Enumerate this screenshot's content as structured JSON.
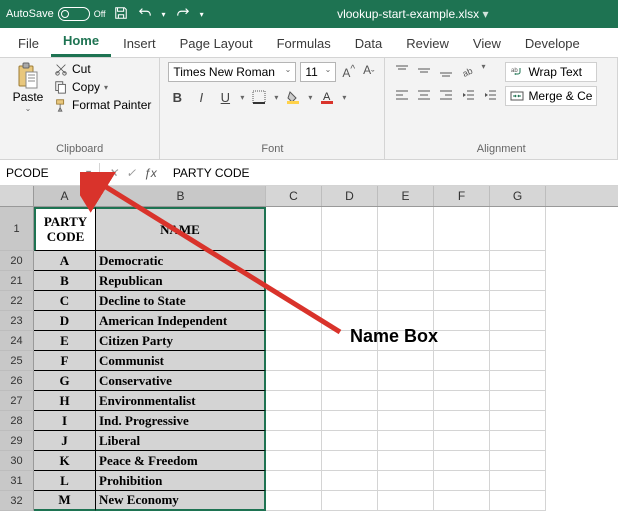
{
  "titlebar": {
    "autosave_label": "AutoSave",
    "autosave_state": "Off",
    "filename": "vlookup-start-example.xlsx"
  },
  "tabs": {
    "items": [
      "File",
      "Home",
      "Insert",
      "Page Layout",
      "Formulas",
      "Data",
      "Review",
      "View",
      "Develope"
    ],
    "active": 1
  },
  "ribbon": {
    "clipboard": {
      "paste": "Paste",
      "cut": "Cut",
      "copy": "Copy",
      "format_painter": "Format Painter",
      "group_label": "Clipboard"
    },
    "font": {
      "name": "Times New Roman",
      "size": "11",
      "group_label": "Font"
    },
    "alignment": {
      "wrap": "Wrap Text",
      "merge": "Merge & Ce",
      "group_label": "Alignment"
    }
  },
  "formula_bar": {
    "name_box": "PCODE",
    "fx_value": "PARTY CODE"
  },
  "columns": [
    "A",
    "B",
    "C",
    "D",
    "E",
    "F",
    "G"
  ],
  "header_row": {
    "num": "1",
    "a": "PARTY CODE",
    "b": "NAME"
  },
  "data_rows": [
    {
      "num": "20",
      "a": "A",
      "b": "Democratic"
    },
    {
      "num": "21",
      "a": "B",
      "b": "Republican"
    },
    {
      "num": "22",
      "a": "C",
      "b": "Decline to State"
    },
    {
      "num": "23",
      "a": "D",
      "b": "American Independent"
    },
    {
      "num": "24",
      "a": "E",
      "b": "Citizen Party"
    },
    {
      "num": "25",
      "a": "F",
      "b": "Communist"
    },
    {
      "num": "26",
      "a": "G",
      "b": "Conservative"
    },
    {
      "num": "27",
      "a": "H",
      "b": "Environmentalist"
    },
    {
      "num": "28",
      "a": "I",
      "b": "Ind. Progressive"
    },
    {
      "num": "29",
      "a": "J",
      "b": "Liberal"
    },
    {
      "num": "30",
      "a": "K",
      "b": "Peace & Freedom"
    },
    {
      "num": "31",
      "a": "L",
      "b": "Prohibition"
    },
    {
      "num": "32",
      "a": "M",
      "b": "New Economy"
    }
  ],
  "annotation": {
    "label": "Name Box"
  }
}
